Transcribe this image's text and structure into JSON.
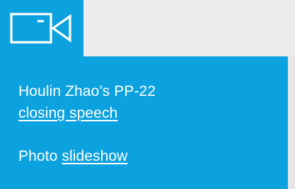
{
  "media_icon": {
    "name": "video-camera-icon",
    "color": "#ffffff",
    "background": "#0ca2df"
  },
  "card": {
    "background": "#0ca2df",
    "headline_text": "Houlin Zhao’s PP-22",
    "headline_link": "closing speech",
    "photo_prefix": "Photo ",
    "photo_link": "slideshow"
  }
}
